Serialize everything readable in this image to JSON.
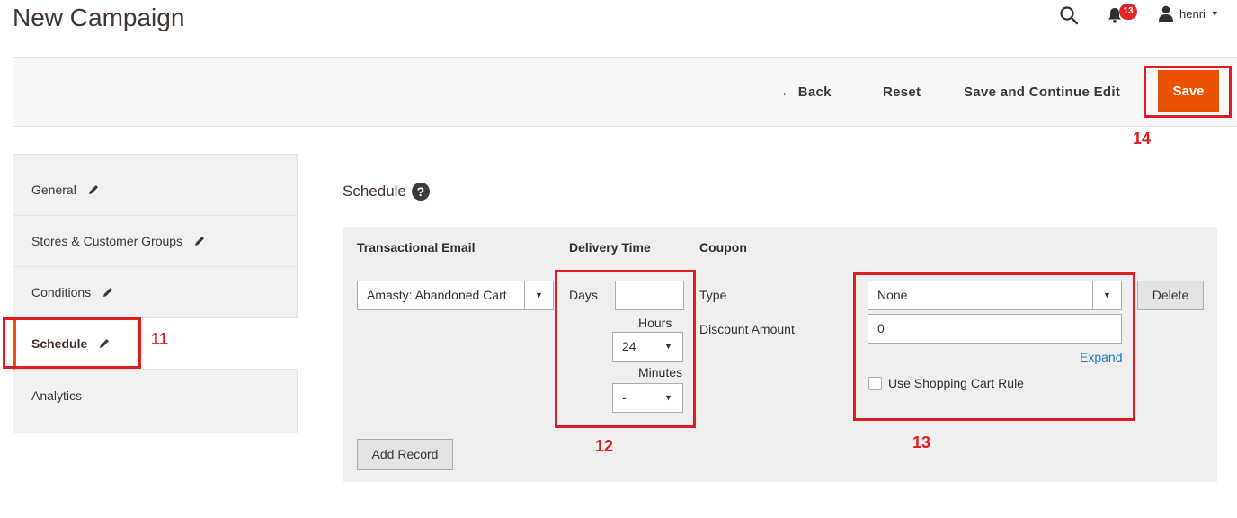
{
  "page": {
    "title": "New Campaign"
  },
  "header": {
    "search_icon": "search-icon",
    "notifications": {
      "icon": "bell-icon",
      "count": "13"
    },
    "user": {
      "icon": "user-icon",
      "name": "henri"
    }
  },
  "actions": {
    "back_label": "← Back",
    "reset_label": "Reset",
    "save_continue_label": "Save and Continue Edit",
    "save_label": "Save"
  },
  "sidebar": {
    "items": [
      {
        "label": "General"
      },
      {
        "label": "Stores & Customer Groups"
      },
      {
        "label": "Conditions"
      },
      {
        "label": "Schedule",
        "active": true
      },
      {
        "label": "Analytics"
      }
    ]
  },
  "schedule": {
    "title": "Schedule",
    "help_icon": "?",
    "columns": [
      "Transactional Email",
      "Delivery Time",
      "Coupon"
    ],
    "row": {
      "email_template": "Amasty: Abandoned Cart",
      "days_label": "Days",
      "days_value": "",
      "hours_label": "Hours",
      "hours_value": "24",
      "minutes_label": "Minutes",
      "minutes_value": "-",
      "coupon_type_label": "Type",
      "coupon_type_value": "None",
      "discount_amount_label": "Discount Amount",
      "discount_amount_value": "0",
      "expand_label": "Expand",
      "use_cart_rule_label": "Use Shopping Cart Rule",
      "use_cart_rule_checked": false,
      "delete_label": "Delete"
    },
    "add_record_label": "Add Record"
  },
  "annotations": {
    "n11": "11",
    "n12": "12",
    "n13": "13",
    "n14": "14"
  },
  "colors": {
    "accent": "#eb5202",
    "highlight": "#e11b22",
    "link": "#1979c3"
  }
}
